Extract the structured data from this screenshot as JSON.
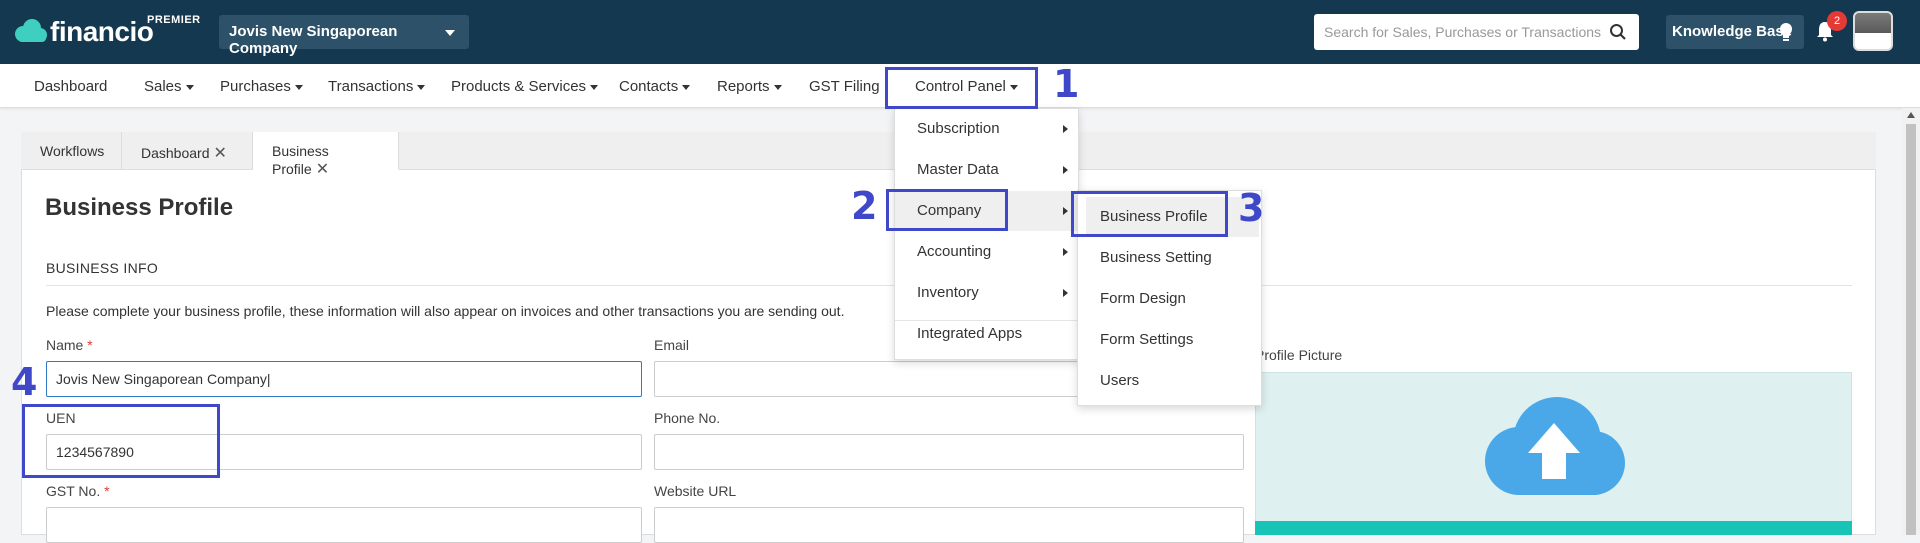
{
  "header": {
    "logo_text": "financio",
    "plan_badge": "PREMIER",
    "company_name": "Jovis New Singaporean Company",
    "search_placeholder": "Search for Sales, Purchases or Transactions",
    "knowledge_base_label": "Knowledge Base",
    "notification_count": "2"
  },
  "nav": {
    "items": [
      {
        "label": "Dashboard"
      },
      {
        "label": "Sales"
      },
      {
        "label": "Purchases"
      },
      {
        "label": "Transactions"
      },
      {
        "label": "Products & Services"
      },
      {
        "label": "Contacts"
      },
      {
        "label": "Reports"
      },
      {
        "label": "GST Filing"
      },
      {
        "label": "Control Panel"
      }
    ]
  },
  "tabs": [
    {
      "label": "Workflows"
    },
    {
      "label": "Dashboard"
    },
    {
      "label": "Business Profile"
    }
  ],
  "page": {
    "title": "Business Profile",
    "section_title": "BUSINESS INFO",
    "hint": "Please complete your business profile, these information will also appear on invoices and other transactions you are sending out.",
    "profile_picture_label": "Profile Picture"
  },
  "form": {
    "name_label": "Name",
    "name_value": "Jovis New Singaporean Company",
    "email_label": "Email",
    "uen_label": "UEN",
    "uen_value": "1234567890",
    "phone_label": "Phone No.",
    "gst_label": "GST No.",
    "website_label": "Website URL",
    "required_marker": "*"
  },
  "control_panel_menu": {
    "items": [
      {
        "label": "Subscription"
      },
      {
        "label": "Master Data"
      },
      {
        "label": "Company"
      },
      {
        "label": "Accounting"
      },
      {
        "label": "Inventory"
      },
      {
        "label": "Integrated Apps"
      }
    ]
  },
  "company_submenu": {
    "items": [
      {
        "label": "Business Profile"
      },
      {
        "label": "Business Setting"
      },
      {
        "label": "Form Design"
      },
      {
        "label": "Form Settings"
      },
      {
        "label": "Users"
      }
    ]
  },
  "annotations": {
    "n1": "1",
    "n2": "2",
    "n3": "3",
    "n4": "4"
  },
  "colors": {
    "header_bg": "#14384f",
    "annotation": "#3f48c8",
    "focus_border": "#2e7bc4",
    "upload_bg": "#dff0f0",
    "upload_bar": "#18c4b6",
    "cloud": "#4aa8e8"
  }
}
